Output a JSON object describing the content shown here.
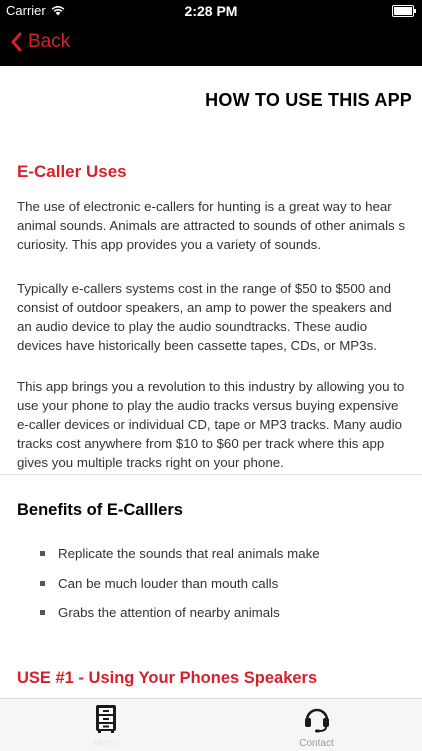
{
  "status_bar": {
    "carrier": "Carrier",
    "time": "2:28 PM"
  },
  "nav": {
    "back_label": "Back"
  },
  "page": {
    "title": "HOW TO USE THIS APP"
  },
  "section1": {
    "heading": "E-Caller Uses",
    "paragraphs": [
      "The use of electronic e-callers for hunting is a great way to hear animal sounds.  Animals are attracted to sounds of other animals s curiosity. This app provides you a variety of sounds.",
      "Typically e-callers systems cost in the range of $50 to $500 and consist of outdoor speakers, an amp to power the speakers and an audio device to play the audio soundtracks.  These audio devices have historically been cassette tapes, CDs, or MP3s.",
      "This app brings you a revolution to this industry by allowing you to use your phone to play the audio tracks versus buying expensive e-caller devices or individual CD, tape or MP3 tracks.  Many audio tracks cost anywhere from $10 to $60 per track where this app gives you multiple tracks right on your phone."
    ]
  },
  "benefits": {
    "heading": "Benefits of E-Calllers",
    "items": [
      "Replicate the sounds that real animals make",
      "Can be much louder than mouth calls",
      "Grabs the attention of nearby animals"
    ]
  },
  "use1": {
    "heading": "USE #1 - Using Your Phones Speakers"
  },
  "tabbar": {
    "tabs": [
      {
        "label": "Menu",
        "icon": "cabinet-icon",
        "active": true
      },
      {
        "label": "Contact",
        "icon": "headset-icon",
        "active": false
      }
    ]
  },
  "colors": {
    "accent": "#d8202b",
    "bar": "#000000"
  }
}
